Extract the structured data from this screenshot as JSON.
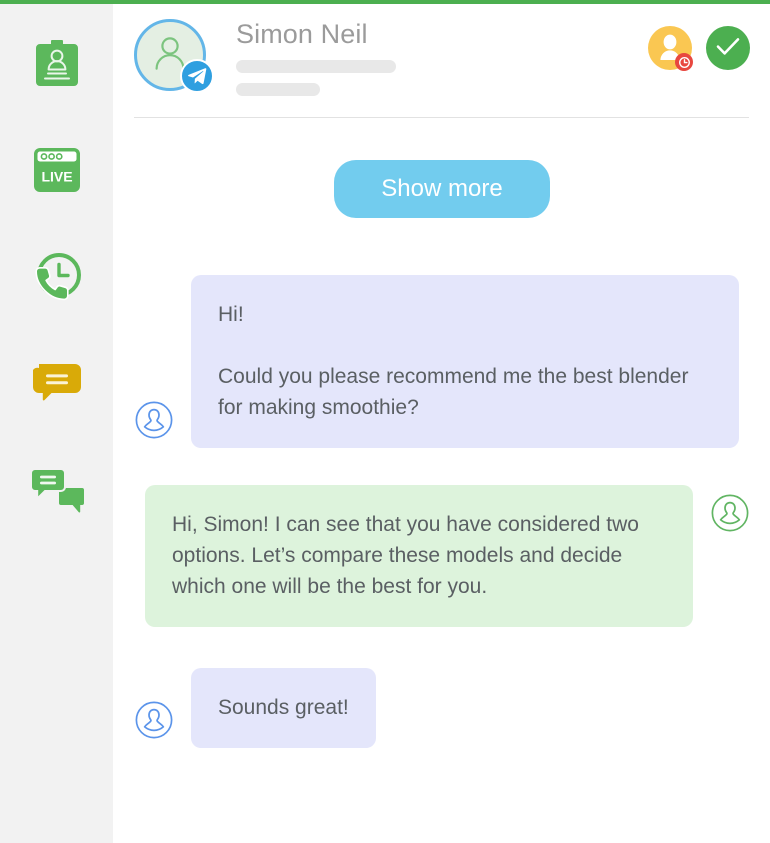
{
  "theme": {
    "accent_green": "#4caf50",
    "rail_bg": "#f2f2f2",
    "telegram_blue": "#2f9fe0",
    "customer_bubble": "#e4e6fb",
    "agent_bubble": "#ddf3dc",
    "show_more_blue": "#72ccee",
    "agent_badge_yellow": "#fac752",
    "alert_red": "#e8473f"
  },
  "sidebar": {
    "items": [
      {
        "id": "contact-card",
        "icon": "id-badge-icon",
        "label": "Contact card"
      },
      {
        "id": "live-view",
        "icon": "live-browser-icon",
        "label": "LIVE",
        "badge_text": "LIVE"
      },
      {
        "id": "call-history",
        "icon": "phone-clock-icon",
        "label": "Call history"
      },
      {
        "id": "notes",
        "icon": "speech-bubble-icon",
        "label": "Notes"
      },
      {
        "id": "chat-history",
        "icon": "double-bubble-icon",
        "label": "Chat history"
      }
    ]
  },
  "header": {
    "avatar_icon": "person-outline-icon",
    "channel_badge_icon": "telegram-icon",
    "contact_name": "Simon Neil",
    "detail_placeholder_1": "",
    "detail_placeholder_2": "",
    "actions": [
      {
        "id": "assign-agent",
        "icon": "agent-person-icon",
        "badge_icon": "clock-icon",
        "label": "Assign agent"
      },
      {
        "id": "resolve",
        "icon": "check-icon",
        "label": "Resolve chat"
      }
    ]
  },
  "conversation": {
    "show_more_label": "Show more",
    "messages": [
      {
        "id": "msg-1",
        "sender": "customer",
        "direction": "incoming",
        "avatar_icon": "person-bust-outline-icon",
        "paragraphs": [
          "Hi!",
          "Could you please recommend me the best blender for making smoothie?"
        ]
      },
      {
        "id": "msg-2",
        "sender": "agent",
        "direction": "outgoing",
        "avatar_icon": "person-bust-outline-icon",
        "paragraphs": [
          "Hi, Simon! I can see that you have considered two options. Let’s compare these models and decide which one will be the best for you."
        ]
      },
      {
        "id": "msg-3",
        "sender": "customer",
        "direction": "incoming",
        "avatar_icon": "person-bust-outline-icon",
        "paragraphs": [
          "Sounds great!"
        ]
      }
    ]
  }
}
